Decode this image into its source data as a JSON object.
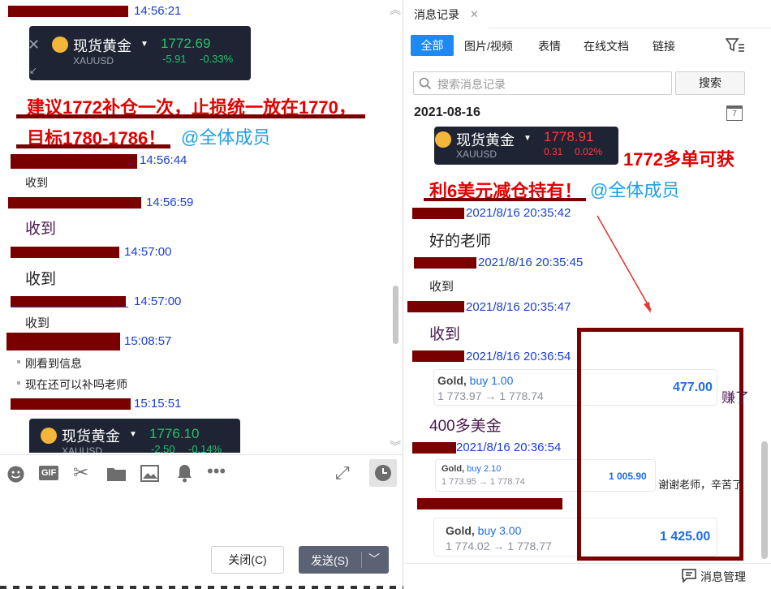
{
  "left": {
    "messages": [
      {
        "time": "14:56:21"
      },
      {
        "time": "14:56:44",
        "text": "收到"
      },
      {
        "time": "14:56:59",
        "text": "收到"
      },
      {
        "time": "14:57:00",
        "text": "收到"
      },
      {
        "time": "14:57:00",
        "text": "收到"
      },
      {
        "time": "15:08:57",
        "bullets": [
          "刚看到信息",
          "现在还可以补吗老师"
        ]
      },
      {
        "time": "15:15:51"
      }
    ],
    "chip1": {
      "name": "现货黄金",
      "symbol": "XAUUSD",
      "price": "1772.69",
      "change": "-5.91",
      "pct": "-0.33%"
    },
    "chip2": {
      "name": "现货黄金",
      "symbol": "XAUUSD",
      "price": "1776.10",
      "change": "-2.50",
      "pct": "-0.14%"
    },
    "red_line1": "建议1772补仓一次，止损统一放在1770，",
    "red_line2": "目标1780-1786！",
    "mention": "@全体成员",
    "toolbar": {
      "gif": "GIF"
    },
    "close_label": "关闭(C)",
    "send_label": "发送(S)"
  },
  "right": {
    "tab_title": "消息记录",
    "tabs": [
      "全部",
      "图片/视频",
      "表情",
      "在线文档",
      "链接"
    ],
    "search_placeholder": "搜索消息记录",
    "search_button": "搜索",
    "date": "2021-08-16",
    "chip": {
      "name": "现货黄金",
      "symbol": "XAUUSD",
      "price": "1778.91",
      "change": "0.31",
      "pct": "0.02%"
    },
    "red_line1": "1772多单可获",
    "red_line2": "利6美元减仓持有！",
    "mention": "@全体成员",
    "msgs": [
      {
        "time": "2021/8/16 20:35:42",
        "text": "好的老师"
      },
      {
        "time": "2021/8/16 20:35:45",
        "text": "收到"
      },
      {
        "time": "2021/8/16 20:35:47",
        "text": "收到"
      },
      {
        "time": "2021/8/16 20:36:54",
        "text": "400多美金"
      },
      {
        "time": "2021/8/16 20:36:54"
      }
    ],
    "trades": [
      {
        "asset": "Gold,",
        "side": "buy 1.00",
        "range": "1 773.97 → 1 778.74",
        "profit": "477.00"
      },
      {
        "asset": "Gold,",
        "side": "buy 2.10",
        "range": "1 773.95 → 1 778.74",
        "profit": "1 005.90"
      },
      {
        "asset": "Gold,",
        "side": "buy 3.00",
        "range": "1 774.02 → 1 778.77",
        "profit": "1 425.00"
      }
    ],
    "note1": "赚了",
    "note2": "谢谢老师，辛苦了",
    "manage": "消息管理"
  }
}
